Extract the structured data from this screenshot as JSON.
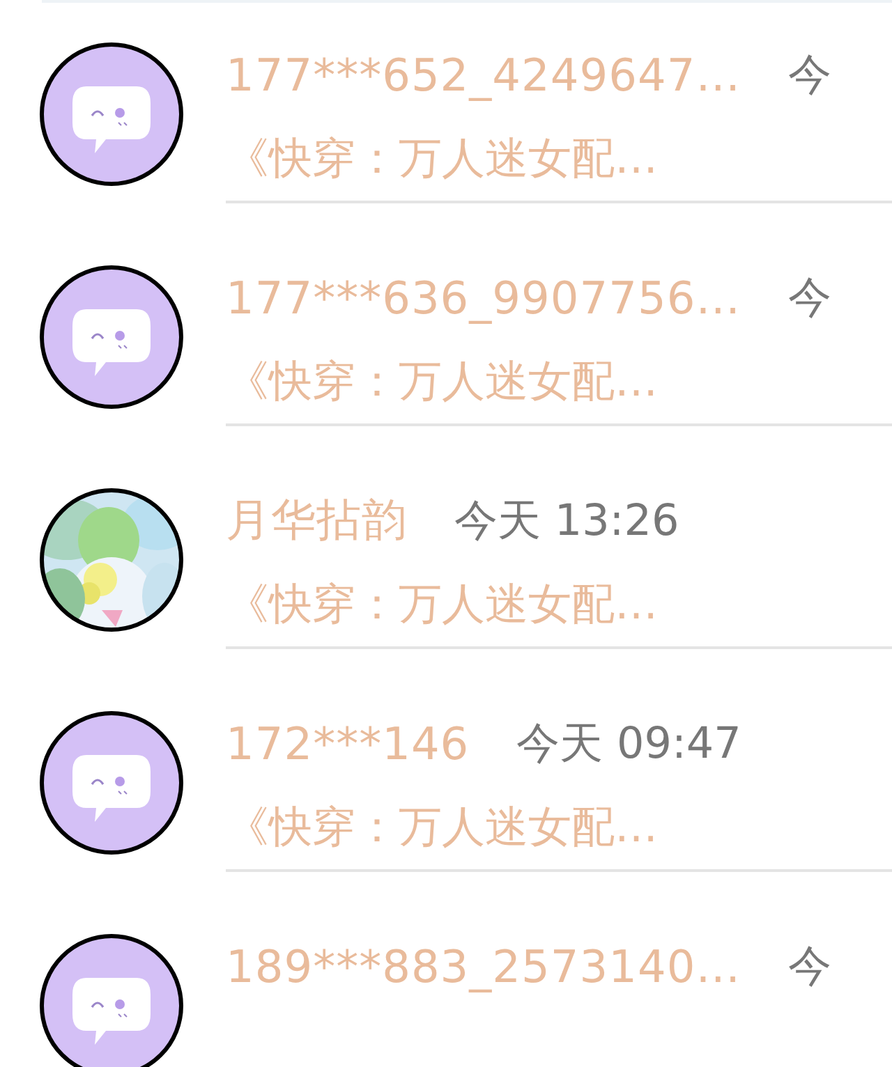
{
  "conversations": [
    {
      "avatar": {
        "kind": "default"
      },
      "name": "177***652_4249647…",
      "time": "今",
      "preview": "《快穿：万人迷女配…"
    },
    {
      "avatar": {
        "kind": "default"
      },
      "name": "177***636_9907756…",
      "time": "今",
      "preview": "《快穿：万人迷女配…"
    },
    {
      "name": "月华拈韵",
      "time": "今天 13:26",
      "preview": "《快穿：万人迷女配…"
    },
    {
      "avatar": {
        "kind": "default"
      },
      "name": "172***146",
      "time": "今天 09:47",
      "preview": "《快穿：万人迷女配…"
    },
    {
      "avatar": {
        "kind": "default"
      },
      "name": "189***883_2573140…",
      "time": "今"
    }
  ]
}
